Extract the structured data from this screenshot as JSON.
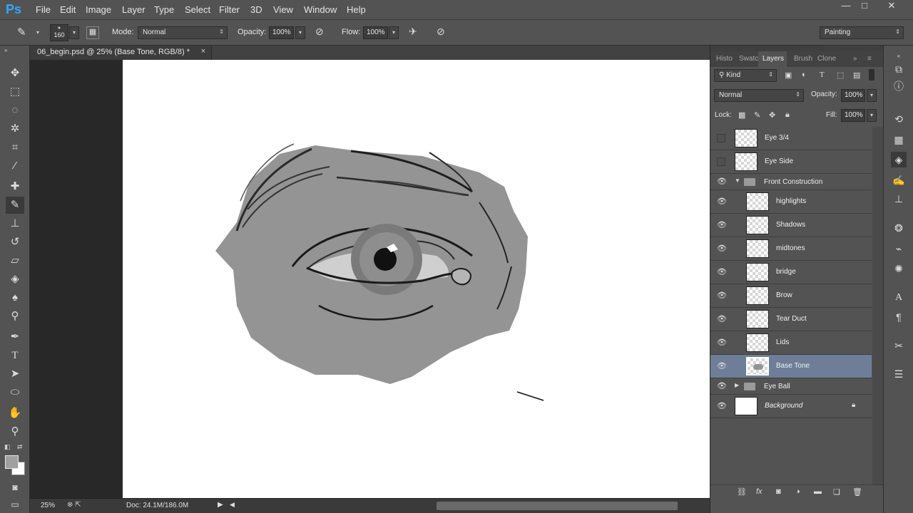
{
  "app": {
    "logo": "Ps"
  },
  "menu": [
    "File",
    "Edit",
    "Image",
    "Layer",
    "Type",
    "Select",
    "Filter",
    "3D",
    "View",
    "Window",
    "Help"
  ],
  "window_controls": {
    "minimize": "—",
    "maximize": "□",
    "close": "✕"
  },
  "options": {
    "brush_size": "160",
    "mode_label": "Mode:",
    "mode_value": "Normal",
    "opacity_label": "Opacity:",
    "opacity_value": "100%",
    "flow_label": "Flow:",
    "flow_value": "100%",
    "workspace": "Painting"
  },
  "document": {
    "tab_title": "06_begin.psd @ 25% (Base Tone, RGB/8) *",
    "close": "×"
  },
  "status": {
    "zoom": "25%",
    "doc_size": "Doc: 24.1M/186.0M"
  },
  "panel": {
    "tabs": [
      "Histo",
      "Swatc",
      "Layers",
      "Brush",
      "Clone"
    ],
    "active_tab": "Layers",
    "filter_kind": "Kind",
    "blend_mode": "Normal",
    "opacity_label": "Opacity:",
    "opacity_value": "100%",
    "lock_label": "Lock:",
    "fill_label": "Fill:",
    "fill_value": "100%"
  },
  "layers": [
    {
      "name": "Eye 3/4",
      "visible": false,
      "type": "layer"
    },
    {
      "name": "Eye Side",
      "visible": false,
      "type": "layer"
    },
    {
      "name": "Front Construction",
      "visible": true,
      "type": "group-open"
    },
    {
      "name": "highlights",
      "visible": true,
      "type": "child"
    },
    {
      "name": "Shadows",
      "visible": true,
      "type": "child"
    },
    {
      "name": "midtones",
      "visible": true,
      "type": "child"
    },
    {
      "name": "bridge",
      "visible": true,
      "type": "child"
    },
    {
      "name": "Brow",
      "visible": true,
      "type": "child"
    },
    {
      "name": "Tear Duct",
      "visible": true,
      "type": "child"
    },
    {
      "name": "Lids",
      "visible": true,
      "type": "child"
    },
    {
      "name": "Base Tone",
      "visible": true,
      "type": "child-selected"
    },
    {
      "name": "Eye Ball",
      "visible": true,
      "type": "group-closed"
    },
    {
      "name": "Background",
      "visible": true,
      "type": "background"
    }
  ],
  "colors": {
    "selected_layer": "#6e7e98",
    "ps_blue": "#31a8ff",
    "sketch_fill": "#949494"
  }
}
